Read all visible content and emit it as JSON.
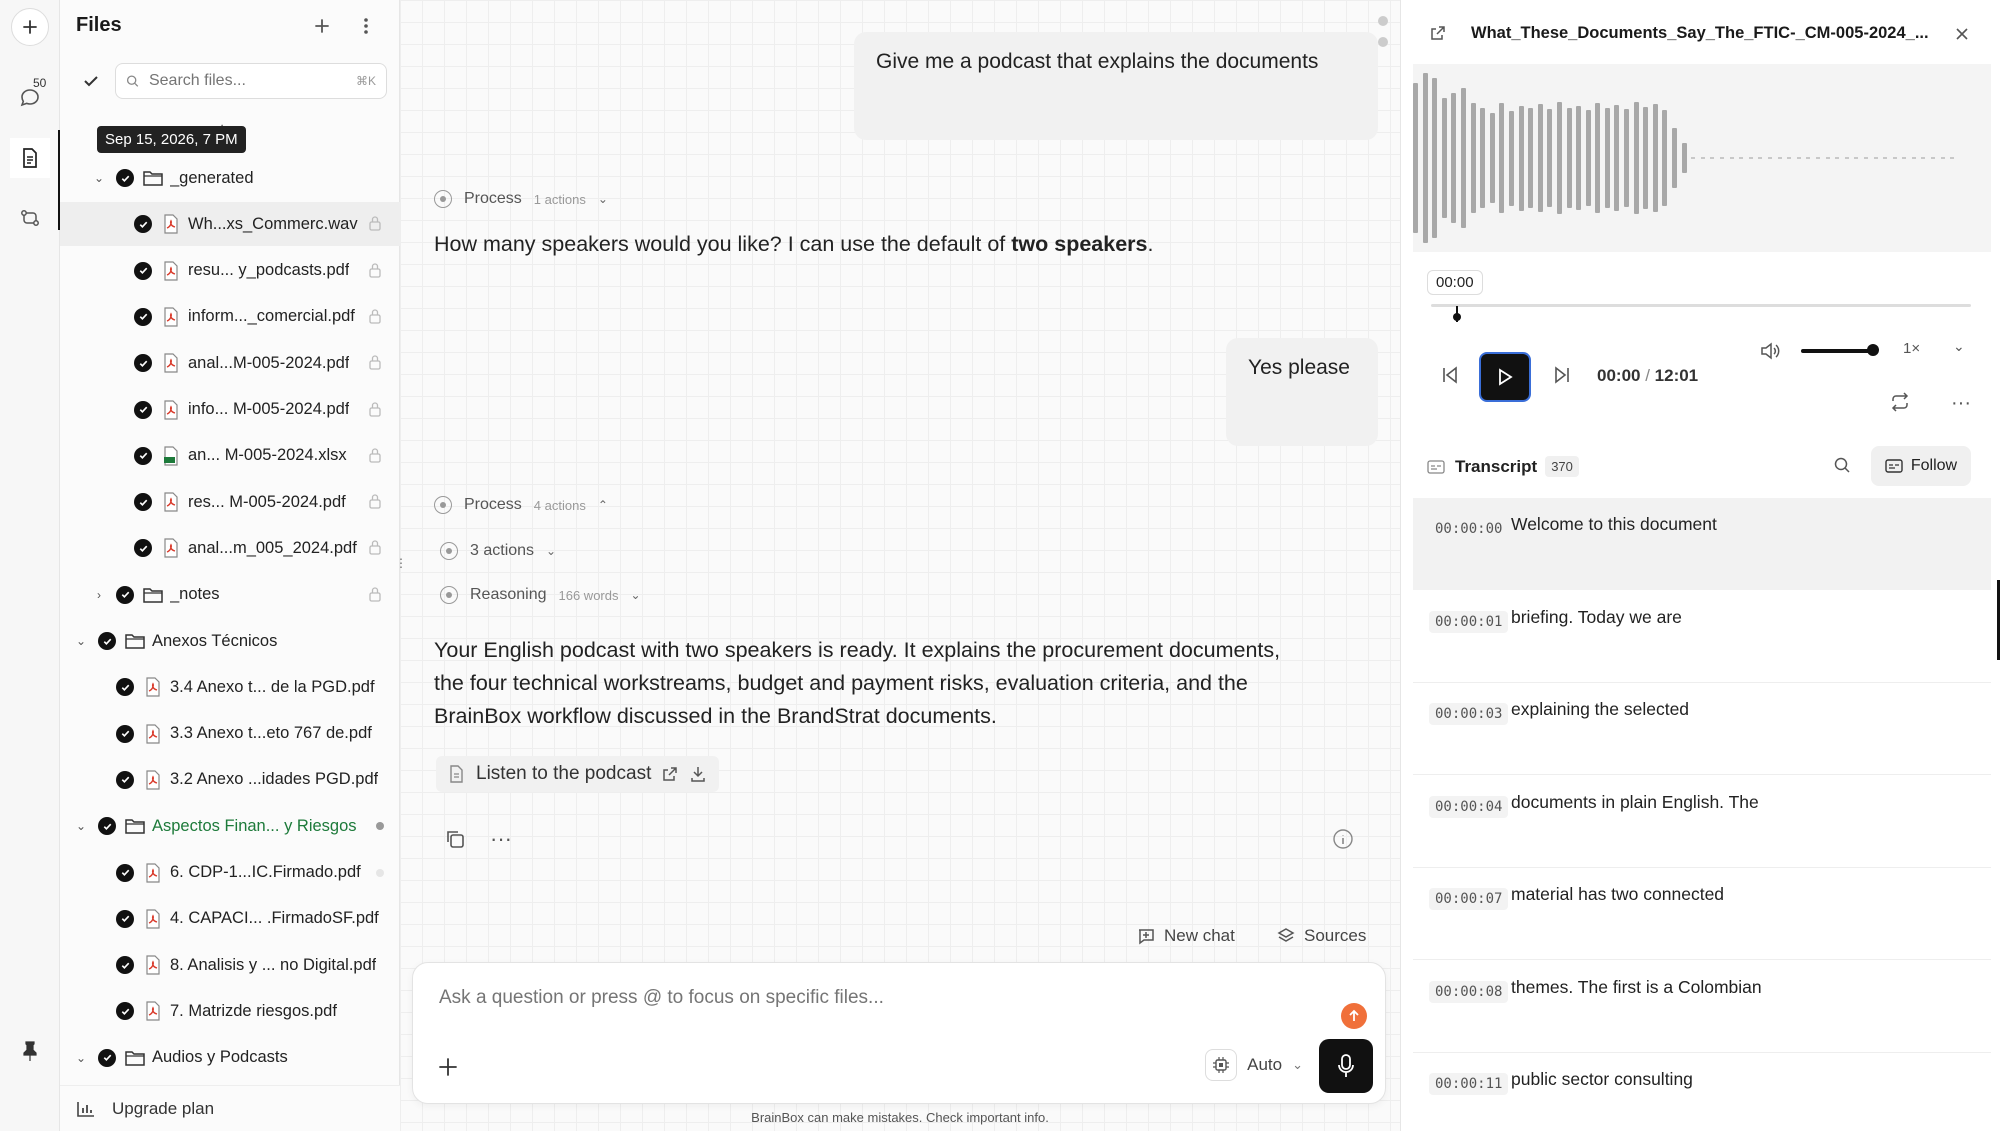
{
  "rail": {
    "badge": "50"
  },
  "files": {
    "title": "Files",
    "search_placeholder": "Search files...",
    "search_shortcut": "⌘K",
    "tooltip": "Sep 15, 2026, 7 PM",
    "partial_label": "te",
    "rows": [
      {
        "label": "_generated",
        "type": "folder",
        "expanded": true
      },
      {
        "label": "Wh...xs_Commerc.wav",
        "type": "pdf"
      },
      {
        "label": "resu...  y_podcasts.pdf",
        "type": "pdf"
      },
      {
        "label": "inform..._comercial.pdf",
        "type": "pdf"
      },
      {
        "label": "anal...M-005-2024.pdf",
        "type": "pdf"
      },
      {
        "label": "info... M-005-2024.pdf",
        "type": "pdf"
      },
      {
        "label": "an...  M-005-2024.xlsx",
        "type": "xlsx"
      },
      {
        "label": "res...  M-005-2024.pdf",
        "type": "pdf"
      },
      {
        "label": "anal...m_005_2024.pdf",
        "type": "pdf"
      },
      {
        "label": "_notes",
        "type": "folder",
        "expanded": false
      },
      {
        "label": "Anexos Técnicos",
        "type": "folder",
        "expanded": true
      },
      {
        "label": "3.4 Anexo t...  de la PGD.pdf",
        "type": "pdf"
      },
      {
        "label": "3.3 Anexo t...eto 767 de.pdf",
        "type": "pdf"
      },
      {
        "label": "3.2 Anexo ...idades PGD.pdf",
        "type": "pdf"
      },
      {
        "label": "Aspectos Finan...  y Riesgos",
        "type": "folder",
        "expanded": true
      },
      {
        "label": "6. CDP-1...IC.Firmado.pdf",
        "type": "pdf"
      },
      {
        "label": "4. CAPACI...  .FirmadoSF.pdf",
        "type": "pdf"
      },
      {
        "label": "8. Analisis y ... no Digital.pdf",
        "type": "pdf"
      },
      {
        "label": "7. Matrizde riesgos.pdf",
        "type": "pdf"
      },
      {
        "label": "Audios y Podcasts",
        "type": "folder",
        "expanded": true
      }
    ],
    "upgrade": "Upgrade plan"
  },
  "chat": {
    "user_msg_1": "Give me a podcast that explains the documents",
    "process_1": {
      "label": "Process",
      "count": "1 actions"
    },
    "assistant_1_prefix": "How many speakers would you like? I can use the default of ",
    "assistant_1_bold": "two speakers",
    "assistant_1_suffix": ".",
    "user_msg_2": "Yes please",
    "process_2": {
      "label": "Process",
      "count": "4 actions"
    },
    "actions_label": "3 actions",
    "reasoning": {
      "label": "Reasoning",
      "count": "166 words"
    },
    "assistant_2": "Your English podcast with two speakers is ready. It explains the procurement documents, the four technical workstreams, budget and payment risks, evaluation criteria, and the BrainBox workflow discussed in the BrandStrat documents.",
    "listen_label": "Listen to the podcast",
    "new_chat": "New chat",
    "sources": "Sources",
    "input_placeholder": "Ask a question or press @ to focus on specific files...",
    "model": "Auto",
    "disclaimer": "BrainBox can make mistakes. Check important info."
  },
  "player": {
    "title": "What_These_Documents_Say_The_FTIC-_CM-005-2024_...",
    "time_pill": "00:00",
    "current": "00:00",
    "total": "12:01",
    "speed": "1×",
    "transcript_label": "Transcript",
    "transcript_count": "370",
    "follow": "Follow",
    "transcript": [
      {
        "ts": "00:00:00",
        "text": "Welcome to this document"
      },
      {
        "ts": "00:00:01",
        "text": "briefing. Today we are"
      },
      {
        "ts": "00:00:03",
        "text": "explaining the selected"
      },
      {
        "ts": "00:00:04",
        "text": "documents in plain English. The"
      },
      {
        "ts": "00:00:07",
        "text": "material has two connected"
      },
      {
        "ts": "00:00:08",
        "text": "themes. The first is a Colombian"
      },
      {
        "ts": "00:00:11",
        "text": "public sector consulting"
      }
    ]
  }
}
